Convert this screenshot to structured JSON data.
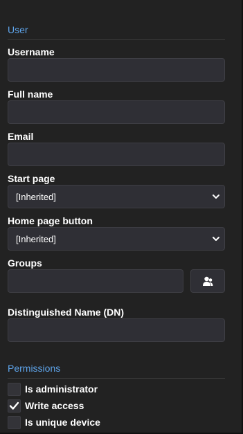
{
  "user_section": {
    "title": "User",
    "username": {
      "label": "Username",
      "value": ""
    },
    "full_name": {
      "label": "Full name",
      "value": ""
    },
    "email": {
      "label": "Email",
      "value": ""
    },
    "start_page": {
      "label": "Start page",
      "value": "[Inherited]"
    },
    "home_page_button": {
      "label": "Home page button",
      "value": "[Inherited]"
    },
    "groups": {
      "label": "Groups",
      "value": "",
      "button_icon": "user-select-icon"
    },
    "dn": {
      "label": "Distinguished Name (DN)",
      "value": ""
    }
  },
  "permissions_section": {
    "title": "Permissions",
    "items": [
      {
        "label": "Is administrator",
        "checked": false
      },
      {
        "label": "Write access",
        "checked": true
      },
      {
        "label": "Is unique device",
        "checked": false
      }
    ]
  },
  "colors": {
    "background": "#222222",
    "section_title": "#5ea4ea",
    "input_bg": "#2f2f35",
    "input_border": "#3e3e44"
  }
}
